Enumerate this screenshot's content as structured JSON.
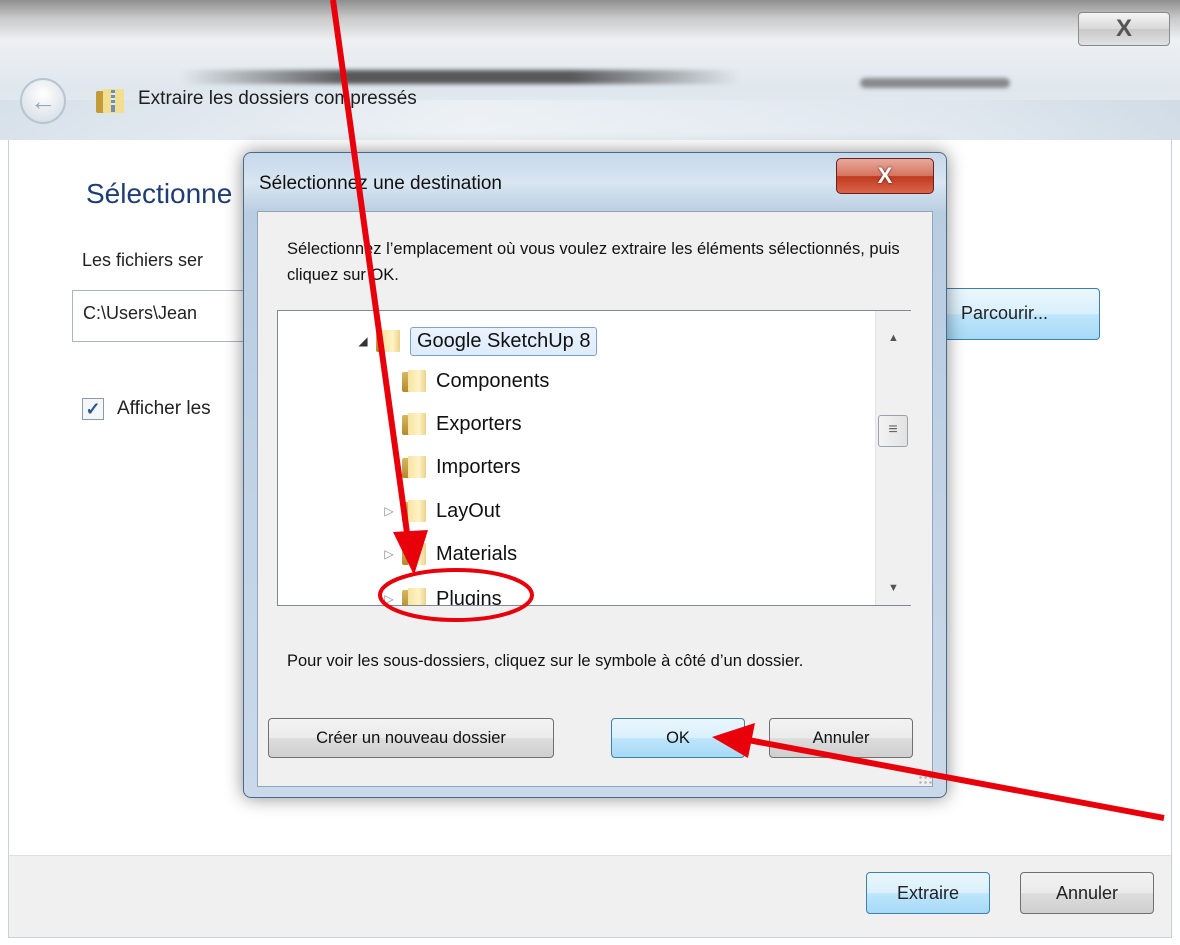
{
  "outer": {
    "title": "Extraire les dossiers compressés",
    "close_glyph": "X",
    "back_glyph": "←",
    "heading": "Sélectionne",
    "files_label": "Les fichiers ser",
    "path_value": "C:\\Users\\Jean",
    "browse_label": "Parcourir...",
    "show_checked": true,
    "show_label": "Afficher les",
    "extract_label": "Extraire",
    "cancel_label": "Annuler"
  },
  "dialog": {
    "title": "Sélectionnez une destination",
    "close_glyph": "X",
    "instruction": "Sélectionnez l’emplacement où vous voulez extraire les éléments sélectionnés, puis cliquez sur OK.",
    "tree": [
      {
        "label": "Google SketchUp 8",
        "expander": "◢",
        "selected": true
      },
      {
        "label": "Components",
        "expander": ""
      },
      {
        "label": "Exporters",
        "expander": ""
      },
      {
        "label": "Importers",
        "expander": ""
      },
      {
        "label": "LayOut",
        "expander": "▷"
      },
      {
        "label": "Materials",
        "expander": "▷"
      },
      {
        "label": "Plugins",
        "expander": "▷"
      }
    ],
    "hint": "Pour voir les sous-dossiers, cliquez sur le symbole à côté d’un dossier.",
    "new_folder_label": "Créer un nouveau dossier",
    "ok_label": "OK",
    "cancel_label": "Annuler"
  },
  "icons": {
    "scroll_up": "▲",
    "scroll_down": "▼",
    "scroll_thumb": "≡",
    "checkmark": "✓"
  },
  "colors": {
    "annotation": "#e8000b",
    "heading": "#1f3f74",
    "close_red": "#c0391f"
  }
}
